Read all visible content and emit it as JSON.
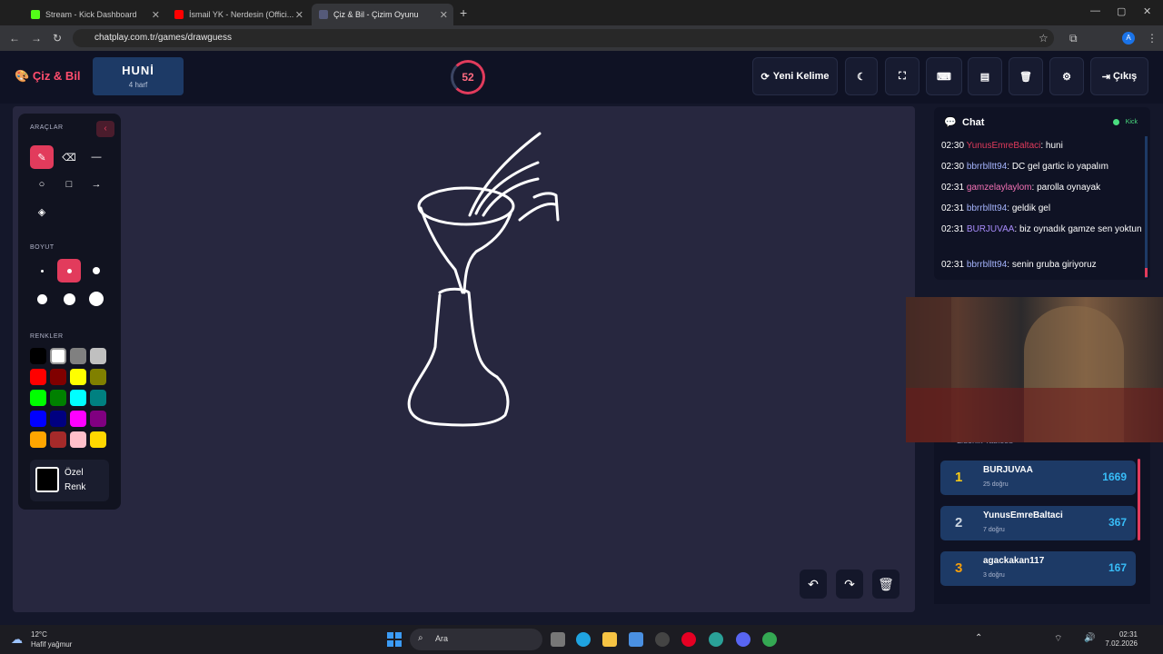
{
  "browser": {
    "tabs": [
      {
        "label": "Stream - Kick Dashboard"
      },
      {
        "label": "İsmail YK - Nerdesin (Offici..."
      },
      {
        "label": "Çiz & Bil - Çizim Oyunu"
      }
    ],
    "url": "chatplay.com.tr/games/drawguess"
  },
  "header": {
    "logo": "Çiz & Bil",
    "word": "HUNİ",
    "hint": "4 harf",
    "timer": "52",
    "new_word": "Yeni Kelime",
    "exit": "Çıkış"
  },
  "tools": {
    "title": "ARAÇLAR",
    "size_title": "BOYUT",
    "colors_title": "RENKLER",
    "custom_line1": "Özel",
    "custom_line2": "Renk",
    "colors": [
      "#000000",
      "#ffffff",
      "#808080",
      "#c0c0c0",
      "#ff0000",
      "#800000",
      "#ffff00",
      "#808000",
      "#00ff00",
      "#008000",
      "#00ffff",
      "#008080",
      "#0000ff",
      "#000080",
      "#ff00ff",
      "#800080",
      "#ffa500",
      "#a52a2a",
      "#ffc0cb",
      "#ffd700"
    ]
  },
  "chat": {
    "title": "Chat",
    "platform": "Kick",
    "messages": [
      {
        "time": "02:30",
        "user": "YunusEmreBaltaci",
        "text": ": huni",
        "color": "#e23b5c"
      },
      {
        "time": "02:30",
        "user": "bbrrblltt94",
        "text": ": DC gel gartic io yapalım",
        "color": "#a5b4fc"
      },
      {
        "time": "02:31",
        "user": "gamzelaylaylom",
        "text": ": parolla oynayak",
        "color": "#f472b6"
      },
      {
        "time": "02:31",
        "user": "bbrrblltt94",
        "text": ": geldik gel",
        "color": "#a5b4fc"
      },
      {
        "time": "02:31",
        "user": "BURJUVAA",
        "text": ": biz oynadık gamze sen yoktun",
        "color": "#a78bfa"
      },
      {
        "time": "02:31",
        "user": "bbrrblltt94",
        "text": ": senin gruba giriyoruz",
        "color": "#a5b4fc"
      }
    ]
  },
  "leaderboard": {
    "title": "Liderlik Tablosu",
    "entries": [
      {
        "rank": "1",
        "name": "BURJUVAA",
        "sub": "25 doğru",
        "score": "1669",
        "color": "#facc15"
      },
      {
        "rank": "2",
        "name": "YunusEmreBaltaci",
        "sub": "7 doğru",
        "score": "367",
        "color": "#cbd5e1"
      },
      {
        "rank": "3",
        "name": "agackakan117",
        "sub": "3 doğru",
        "score": "167",
        "color": "#f59e0b"
      }
    ]
  },
  "taskbar": {
    "temp": "12°C",
    "weather": "Hafif yağmur",
    "search": "Ara",
    "time": "02:31",
    "date": "7.02.2026"
  },
  "accent": "#e23b5c"
}
